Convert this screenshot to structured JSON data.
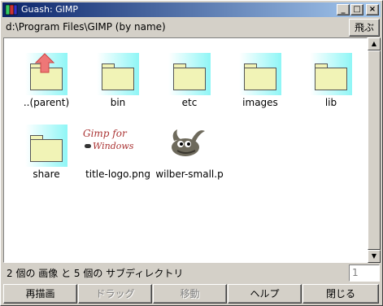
{
  "window": {
    "title": "Guash: GIMP"
  },
  "pathbar": {
    "path": "d:\\Program Files\\GIMP (by name)",
    "jump_label": "飛ぶ"
  },
  "items": [
    {
      "label": "..(parent)",
      "icon": "parent-folder-icon"
    },
    {
      "label": "bin",
      "icon": "folder-icon"
    },
    {
      "label": "etc",
      "icon": "folder-icon"
    },
    {
      "label": "images",
      "icon": "folder-icon"
    },
    {
      "label": "lib",
      "icon": "folder-icon"
    },
    {
      "label": "share",
      "icon": "folder-icon"
    },
    {
      "label": "title-logo.png",
      "icon": "image-thumbnail",
      "logo_text_1": "Gimp for",
      "logo_text_2": "Windows"
    },
    {
      "label": "wilber-small.p",
      "icon": "wilber-thumbnail"
    }
  ],
  "status": {
    "text": "2 個の 画像 と 5 個の サブディレクトリ",
    "page": "1"
  },
  "buttons": {
    "redraw": "再描画",
    "drag": "ドラッグ",
    "move": "移動",
    "help": "ヘルプ",
    "close": "閉じる"
  },
  "colors": {
    "title_start": "#0a246a",
    "title_end": "#a6caf0",
    "folder_glow": "#8ff6f6",
    "folder_fill": "#f1f3b6"
  }
}
